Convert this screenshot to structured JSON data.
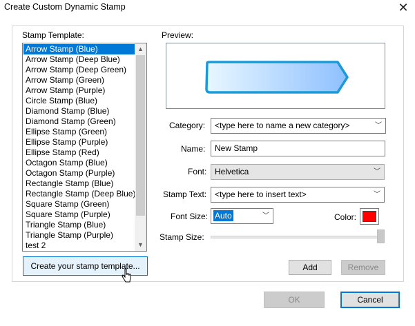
{
  "window": {
    "title": "Create Custom Dynamic Stamp",
    "close_icon": "close-icon"
  },
  "template_label": "Stamp Template:",
  "templates": [
    "Arrow Stamp (Blue)",
    "Arrow Stamp (Deep Blue)",
    "Arrow Stamp (Deep Green)",
    "Arrow Stamp (Green)",
    "Arrow Stamp (Purple)",
    "Circle Stamp (Blue)",
    "Diamond Stamp (Blue)",
    "Diamond Stamp (Green)",
    "Ellipse Stamp (Green)",
    "Ellipse Stamp (Purple)",
    "Ellipse Stamp (Red)",
    "Octagon Stamp (Blue)",
    "Octagon Stamp (Purple)",
    "Rectangle Stamp (Blue)",
    "Rectangle Stamp (Deep Blue)",
    "Square Stamp (Green)",
    "Square Stamp (Purple)",
    "Triangle Stamp (Blue)",
    "Triangle Stamp (Purple)",
    "test 2"
  ],
  "selected_template_index": 0,
  "create_template_label": "Create your stamp template...",
  "preview_label": "Preview:",
  "category": {
    "label": "Category:",
    "value": "<type here to name a new category>"
  },
  "name": {
    "label": "Name:",
    "value": "New Stamp"
  },
  "font": {
    "label": "Font:",
    "value": "Helvetica"
  },
  "stamp_text": {
    "label": "Stamp Text:",
    "value": "<type here to insert text>"
  },
  "font_size": {
    "label": "Font Size:",
    "value": "Auto"
  },
  "color": {
    "label": "Color:",
    "value": "#ff0000"
  },
  "stamp_size": {
    "label": "Stamp Size:",
    "level": 1.0
  },
  "buttons": {
    "add": "Add",
    "remove": "Remove",
    "ok": "OK",
    "cancel": "Cancel"
  },
  "colors": {
    "accent": "#0078d7",
    "stamp_border": "#1a9bd7",
    "stamp_fill_light": "#e8f7ff",
    "stamp_fill_dark": "#8ec0ff"
  }
}
